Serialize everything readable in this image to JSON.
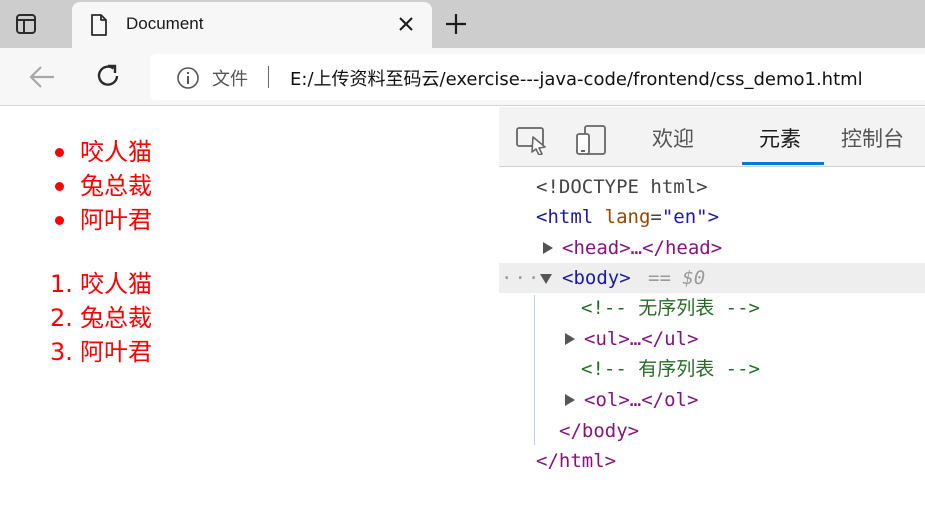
{
  "browser": {
    "tab_title": "Document",
    "address_label": "文件",
    "url": "E:/上传资料至码云/exercise---java-code/frontend/css_demo1.html"
  },
  "page": {
    "unordered_list": [
      "咬人猫",
      "兔总裁",
      "阿叶君"
    ],
    "ordered_list": [
      "咬人猫",
      "兔总裁",
      "阿叶君"
    ],
    "ordered_markers": [
      "1.",
      "2.",
      "3."
    ],
    "text_color": "#ff0000"
  },
  "devtools": {
    "tabs": [
      "欢迎",
      "元素",
      "控制台"
    ],
    "active_tab": "元素",
    "lines": {
      "doctype": "<!DOCTYPE html>",
      "html_open_a": "<html ",
      "html_attr": "lang",
      "html_eq": "=",
      "html_val": "\"en\"",
      "html_open_b": ">",
      "head": "<head>…</head>",
      "dots": "···",
      "body_open": "<body>",
      "body_marker": "== $0",
      "comment_ul": "<!-- 无序列表 -->",
      "ul": "<ul>…</ul>",
      "comment_ol": "<!-- 有序列表 -->",
      "ol": "<ol>…</ol>",
      "body_close": "</body>",
      "html_close": "</html>"
    }
  }
}
